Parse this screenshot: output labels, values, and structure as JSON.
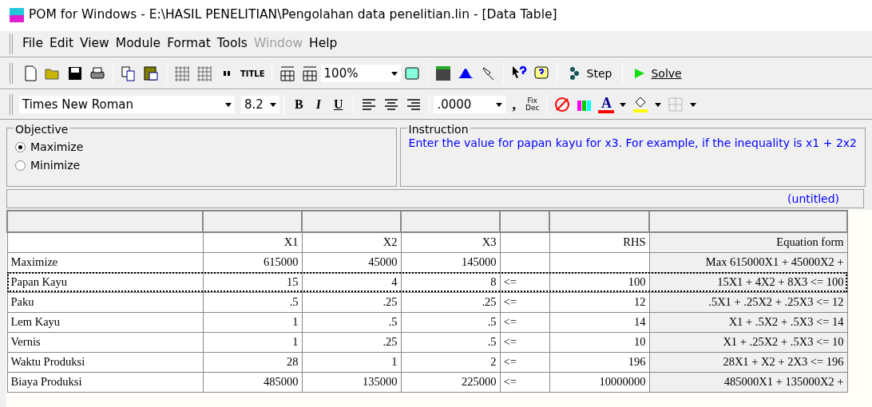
{
  "window": {
    "title": "POM for Windows - E:\\HASIL PENELITIAN\\Pengolahan data penelitian.lin - [Data Table]"
  },
  "menu": [
    {
      "label": "File",
      "disabled": false
    },
    {
      "label": "Edit",
      "disabled": false
    },
    {
      "label": "View",
      "disabled": false
    },
    {
      "label": "Module",
      "disabled": false
    },
    {
      "label": "Format",
      "disabled": false
    },
    {
      "label": "Tools",
      "disabled": false
    },
    {
      "label": "Window",
      "disabled": true
    },
    {
      "label": "Help",
      "disabled": false
    }
  ],
  "toolbar": {
    "title_button": "TITLE",
    "zoom": "100%",
    "step": "Step",
    "solve": "Solve"
  },
  "format_bar": {
    "font": "Times New Roman",
    "size": "8.2",
    "bold": "B",
    "italic": "I",
    "underline": "U",
    "decimals": ".0000",
    "comma": ",",
    "fix": "Fix",
    "dec": "Dec",
    "font_color": "A"
  },
  "objective": {
    "title": "Objective",
    "options": [
      {
        "label": "Maximize",
        "selected": true
      },
      {
        "label": "Minimize",
        "selected": false
      }
    ]
  },
  "instruction": {
    "title": "Instruction",
    "text": "Enter the value for papan kayu for x3. For example, if the inequality is x1 + 2x2"
  },
  "table": {
    "caption": "(untitled)",
    "columns": [
      "",
      "X1",
      "X2",
      "X3",
      "",
      "RHS",
      "Equation form"
    ],
    "rows": [
      {
        "cells": [
          "Maximize",
          "615000",
          "45000",
          "145000",
          "",
          ""
        ],
        "equation": "Max  615000X1 +  45000X2 +",
        "focused": false
      },
      {
        "cells": [
          "Papan Kayu",
          "15",
          "4",
          "8",
          "<=",
          "100"
        ],
        "equation": "15X1 +  4X2 +  8X3 <= 100",
        "focused": true
      },
      {
        "cells": [
          "Paku",
          ".5",
          ".25",
          ".25",
          "<=",
          "12"
        ],
        "equation": ".5X1 +  .25X2 +  .25X3 <= 12",
        "focused": false
      },
      {
        "cells": [
          "Lem Kayu",
          "1",
          ".5",
          ".5",
          "<=",
          "14"
        ],
        "equation": "X1 +  .5X2 +  .5X3 <= 14",
        "focused": false
      },
      {
        "cells": [
          "Vernis",
          "1",
          ".25",
          ".5",
          "<=",
          "10"
        ],
        "equation": "X1 +  .25X2 +  .5X3 <= 10",
        "focused": false
      },
      {
        "cells": [
          "Waktu Produksi",
          "28",
          "1",
          "2",
          "<=",
          "196"
        ],
        "equation": "28X1 + X2 +  2X3 <= 196",
        "focused": false
      },
      {
        "cells": [
          "Biaya Produksi",
          "485000",
          "135000",
          "225000",
          "<=",
          "10000000"
        ],
        "equation": "485000X1 +  135000X2 +",
        "focused": false
      }
    ]
  }
}
